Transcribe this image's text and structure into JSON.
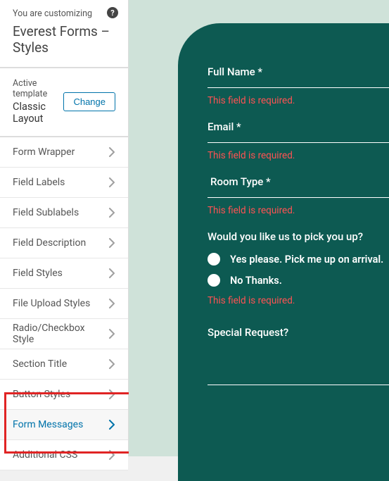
{
  "header": {
    "sub": "You are customizing",
    "title": "Everest Forms – Styles"
  },
  "template": {
    "label": "Active template",
    "value": "Classic Layout",
    "change": "Change"
  },
  "menu": [
    {
      "label": "Form Wrapper",
      "active": false
    },
    {
      "label": "Field Labels",
      "active": false
    },
    {
      "label": "Field Sublabels",
      "active": false
    },
    {
      "label": "Field Description",
      "active": false
    },
    {
      "label": "Field Styles",
      "active": false
    },
    {
      "label": "File Upload Styles",
      "active": false
    },
    {
      "label": "Radio/Checkbox Style",
      "active": false
    },
    {
      "label": "Section Title",
      "active": false
    },
    {
      "label": "Button Styles",
      "active": false
    },
    {
      "label": "Form Messages",
      "active": true
    },
    {
      "label": "Additional CSS",
      "active": false
    }
  ],
  "form": {
    "fields": [
      {
        "label": "Full Name *",
        "error": "This field is required."
      },
      {
        "label": "Email *",
        "error": "This field is required."
      },
      {
        "label": "Room Type *",
        "error": "This field is required."
      }
    ],
    "question": "Would you like us to pick you up?",
    "options": [
      "Yes please. Pick me up on arrival.",
      "No Thanks."
    ],
    "questionError": "This field is required.",
    "special": "Special Request?"
  }
}
